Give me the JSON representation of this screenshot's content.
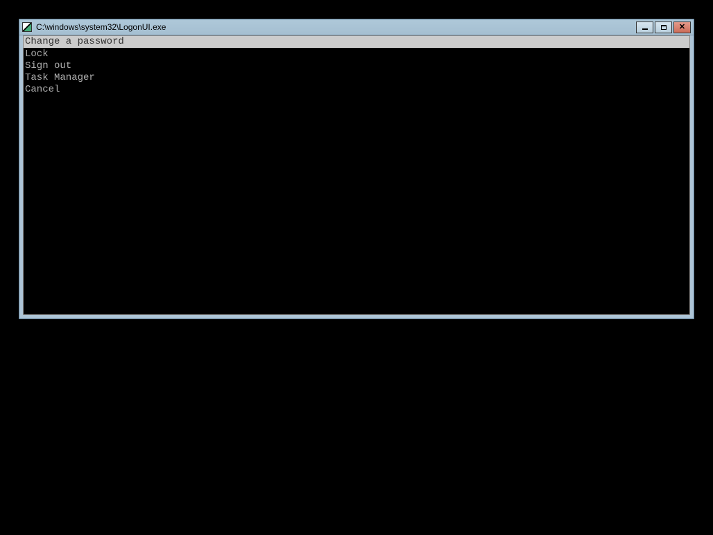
{
  "window": {
    "title": "C:\\windows\\system32\\LogonUI.exe"
  },
  "menu": {
    "selected": "Change a password",
    "items": [
      "Lock",
      "Sign out",
      "Task Manager",
      "Cancel"
    ]
  }
}
